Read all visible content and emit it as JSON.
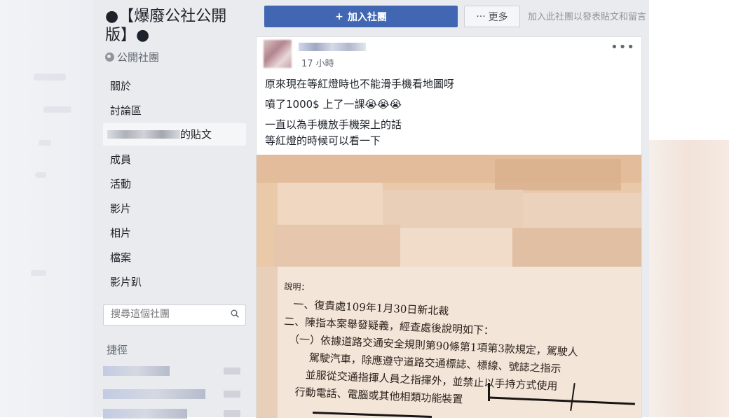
{
  "group": {
    "title": "●【爆廢公社公開版】●",
    "type_label": "公開社團"
  },
  "nav": {
    "about": "關於",
    "discussion": "討論區",
    "posts_suffix": "的貼文",
    "members": "成員",
    "events": "活動",
    "videos": "影片",
    "photos": "相片",
    "files": "檔案",
    "video_party": "影片趴"
  },
  "search": {
    "placeholder": "搜尋這個社團"
  },
  "shortcuts": {
    "heading": "捷徑"
  },
  "actions": {
    "join_label": "加入社團",
    "join_icon": "plus-icon",
    "more_label": "更多",
    "more_icon": "ellipsis-icon",
    "join_hint": "加入此社團以發表貼文和留言"
  },
  "post": {
    "time": "17 小時",
    "lines": [
      "原來現在等紅燈時也不能滑手機看地圖呀",
      "噴了1000$ 上了一課😭😭😭",
      "一直以為手機放手機架上的話",
      "等紅燈的時候可以看一下"
    ],
    "options_icon": "ellipsis-icon"
  },
  "document": {
    "lines": [
      "說明：",
      "一、復貴處109年1月30日新北裁",
      "二、陳指本案舉發疑義，經查處後說明如下：",
      "（一）依據道路交通安全規則第90條第1項第3款規定，駕駛人",
      "駕駛汽車，除應遵守道路交通標誌、標線、號誌之指示",
      "並服從交通指揮人員之指揮外，並禁止以手持方式使用",
      "行動電話、電腦或其他相類功能裝置"
    ]
  },
  "colors": {
    "brand": "#4267b2",
    "sidebar_bg": "#e9ebee",
    "text": "#1d2129",
    "muted": "#606770"
  }
}
